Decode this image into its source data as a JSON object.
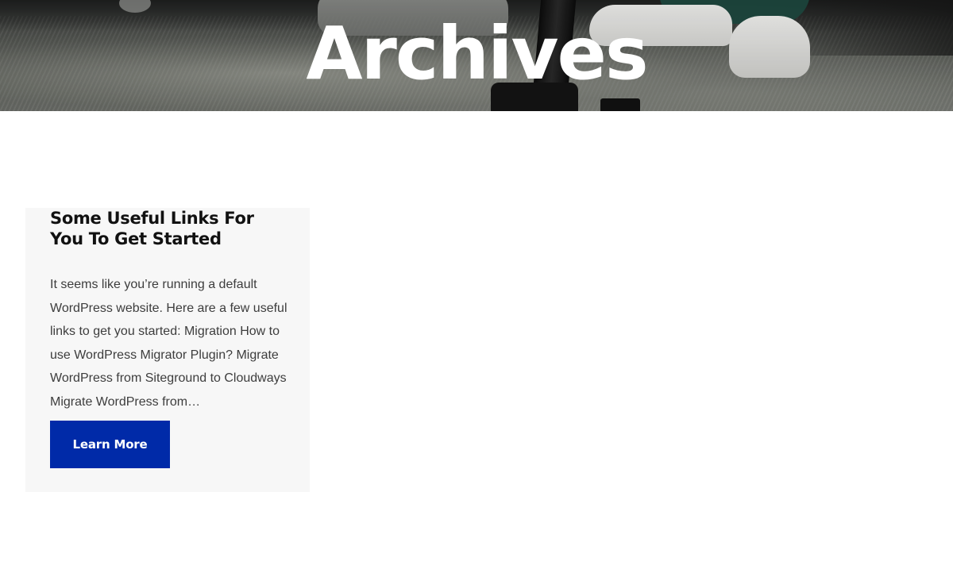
{
  "hero": {
    "title": "Archives"
  },
  "posts": [
    {
      "title": "Some Useful Links For You To Get Started",
      "excerpt": "It seems like you’re running a default WordPress website. Here are a few useful links to get you started: Migration How to use WordPress Migrator Plugin? Migrate WordPress from Siteground to Cloudways Migrate WordPress from…",
      "button_label": "Learn More"
    }
  ],
  "colors": {
    "button_bg": "#002aa8",
    "card_bg": "#f7f7f7",
    "title_text": "#111111",
    "body_text": "#3d3d3d"
  }
}
